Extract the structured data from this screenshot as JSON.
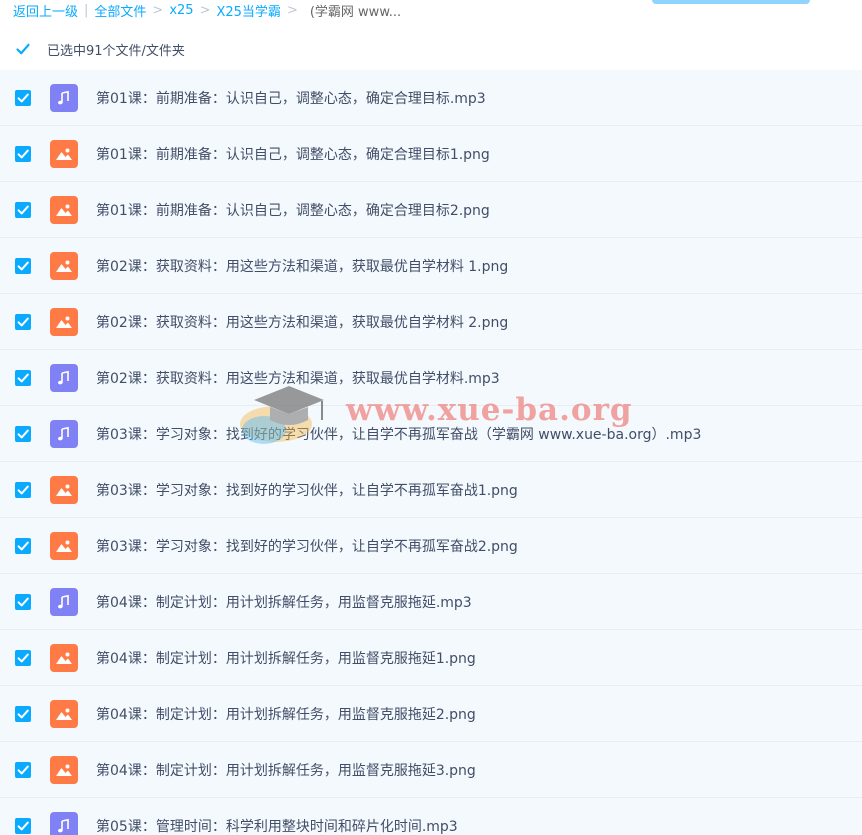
{
  "breadcrumb": {
    "back": "返回上一级",
    "all_files": "全部文件",
    "crumbs": [
      "x25",
      "X25当学霸"
    ],
    "current": "(学霸网 www..."
  },
  "selection": {
    "label": "已选中91个文件/文件夹"
  },
  "files": [
    {
      "name": "第01课：前期准备：认识自己，调整心态，确定合理目标.mp3",
      "type": "audio"
    },
    {
      "name": "第01课：前期准备：认识自己，调整心态，确定合理目标1.png",
      "type": "image"
    },
    {
      "name": "第01课：前期准备：认识自己，调整心态，确定合理目标2.png",
      "type": "image"
    },
    {
      "name": "第02课：获取资料：用这些方法和渠道，获取最优自学材料 1.png",
      "type": "image"
    },
    {
      "name": "第02课：获取资料：用这些方法和渠道，获取最优自学材料 2.png",
      "type": "image"
    },
    {
      "name": "第02课：获取资料：用这些方法和渠道，获取最优自学材料.mp3",
      "type": "audio"
    },
    {
      "name": "第03课：学习对象：找到好的学习伙伴，让自学不再孤军奋战（学霸网 www.xue-ba.org）.mp3",
      "type": "audio"
    },
    {
      "name": "第03课：学习对象：找到好的学习伙伴，让自学不再孤军奋战1.png",
      "type": "image"
    },
    {
      "name": "第03课：学习对象：找到好的学习伙伴，让自学不再孤军奋战2.png",
      "type": "image"
    },
    {
      "name": "第04课：制定计划：用计划拆解任务，用监督克服拖延.mp3",
      "type": "audio"
    },
    {
      "name": "第04课：制定计划：用计划拆解任务，用监督克服拖延1.png",
      "type": "image"
    },
    {
      "name": "第04课：制定计划：用计划拆解任务，用监督克服拖延2.png",
      "type": "image"
    },
    {
      "name": "第04课：制定计划：用计划拆解任务，用监督克服拖延3.png",
      "type": "image"
    },
    {
      "name": "第05课：管理时间：科学利用整块时间和碎片化时间.mp3",
      "type": "audio"
    }
  ],
  "watermark": {
    "text": "www.xue-ba.org"
  },
  "colors": {
    "accent": "#09aaff",
    "audio_icon": "#8081f5",
    "image_icon": "#ff7a45",
    "row_bg": "#f4f9fe",
    "text": "#424e67"
  }
}
